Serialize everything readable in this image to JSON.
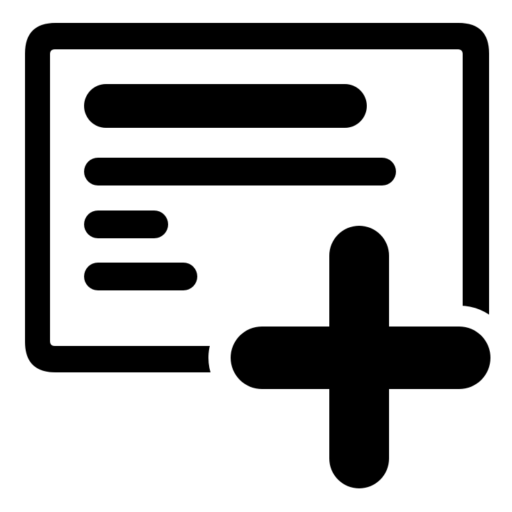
{
  "icon": {
    "name": "add-document-icon",
    "foreground_color": "#000000",
    "background_color": "#ffffff"
  }
}
